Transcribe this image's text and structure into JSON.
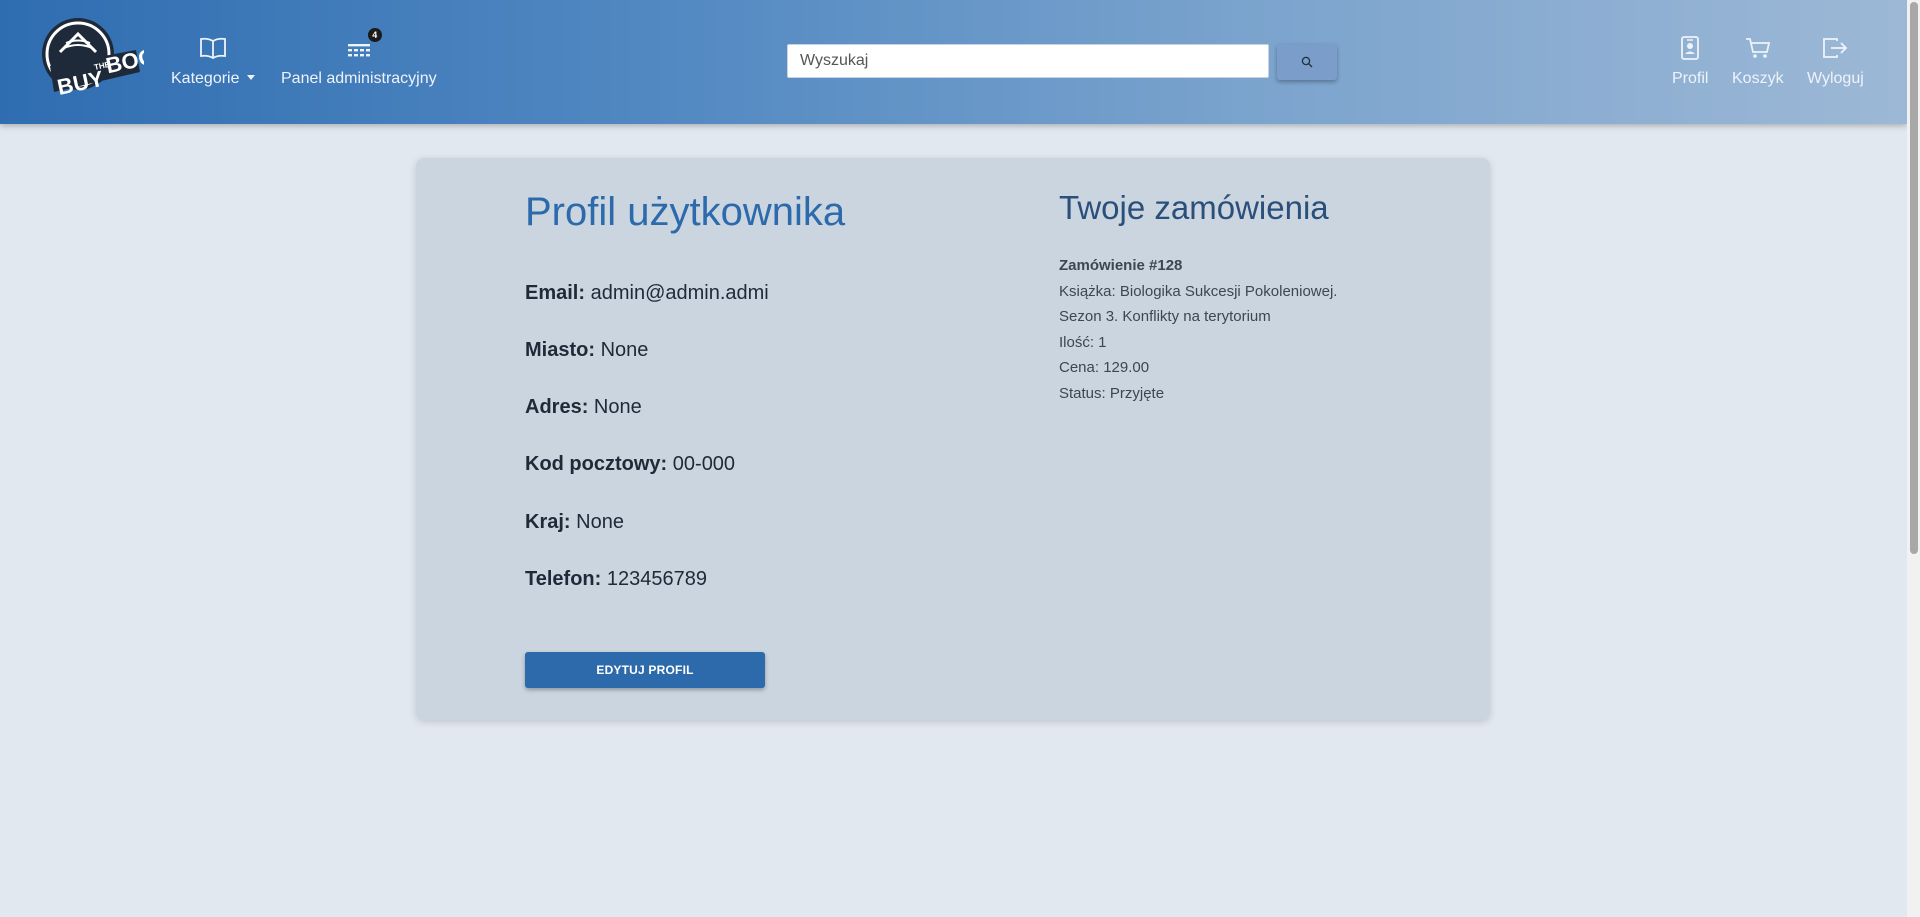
{
  "navbar": {
    "logo_text": [
      "BUY",
      "THE",
      "BOOK"
    ],
    "categories_label": "Kategorie",
    "admin_panel_label": "Panel administracyjny",
    "admin_badge": "4",
    "search_placeholder": "Wyszukaj",
    "profile_label": "Profil",
    "cart_label": "Koszyk",
    "logout_label": "Wyloguj"
  },
  "profile": {
    "title": "Profil użytkownika",
    "fields": [
      {
        "label": "Email:",
        "value": "admin@admin.admi"
      },
      {
        "label": "Miasto:",
        "value": "None"
      },
      {
        "label": "Adres:",
        "value": "None"
      },
      {
        "label": "Kod pocztowy:",
        "value": "00-000"
      },
      {
        "label": "Kraj:",
        "value": "None"
      },
      {
        "label": "Telefon:",
        "value": "123456789"
      }
    ],
    "edit_button": "EDYTUJ PROFIL"
  },
  "orders": {
    "title": "Twoje zamówienia",
    "items": [
      {
        "number": "Zamówienie #128",
        "book_line1": "Książka: Biologika Sukcesji Pokoleniowej.",
        "book_line2": "Sezon 3. Konflikty na terytorium",
        "quantity": "Ilość: 1",
        "price": "Cena: 129.00",
        "status": "Status: Przyjęte"
      }
    ]
  },
  "icons": {
    "categories": "book-open-icon",
    "admin_panel": "list-icon",
    "search": "search-icon",
    "profile": "id-card-icon",
    "cart": "cart-icon",
    "logout": "logout-icon"
  },
  "colors": {
    "accent": "#2c6aab",
    "card_bg": "#cbd5e0",
    "page_bg": "#e2e8f0"
  }
}
